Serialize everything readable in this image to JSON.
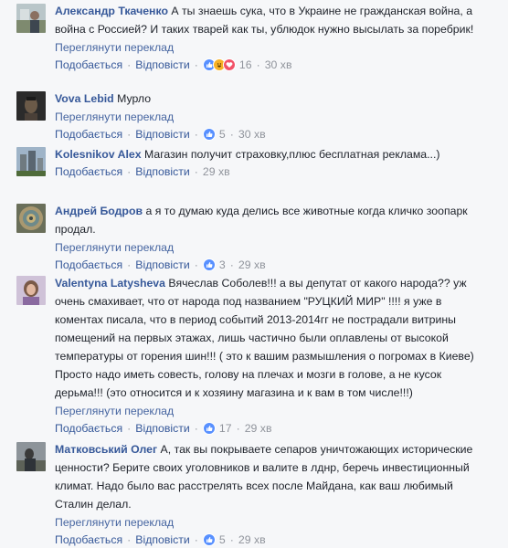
{
  "labels": {
    "translate": "Переглянути переклад",
    "like": "Подобається",
    "reply": "Відповісти",
    "separator": "·"
  },
  "comments": [
    {
      "author": "Александр Ткаченко",
      "text": "А ты знаешь сука, что в Украине не гражданская война, а война с Россией? И таких тварей как ты, ублюдок нужно высылать за поребрик!",
      "reactions": [
        "like-icon",
        "haha-icon",
        "love-icon"
      ],
      "reaction_count": "16",
      "time": "30 хв"
    },
    {
      "author": "Vova Lebid",
      "text": "Мурло",
      "reactions": [
        "like-icon"
      ],
      "reaction_count": "5",
      "time": "30 хв"
    },
    {
      "author": "Kolesnikov Alex",
      "text": "Магазин получит страховку,плюс бесплатная реклама...)",
      "reactions": [],
      "reaction_count": "",
      "time": "29 хв"
    },
    {
      "author": "Андрей Бодров",
      "text": "а я то думаю куда делись все животные когда кличко зоопарк продал.",
      "reactions": [
        "like-icon"
      ],
      "reaction_count": "3",
      "time": "29 хв"
    },
    {
      "author": "Valentyna Latysheva",
      "text": "Вячеслав Соболев!!! а вы депутат от какого народа?? уж очень смахивает, что от народа под названием \"РУЦКИЙ МИР\" !!!! я уже в коментах писала, что в период событий 2013-2014гг не пострадали витрины помещений на первых этажах, лишь частично были оплавлены от высокой температуры от горения шин!!! ( это к вашим размышления о погромах в Киеве) Просто надо иметь совесть, голову на плечах и мозги в голове, а не кусок дерьма!!! (это относится и к хозяину магазина и к вам в том числе!!!)",
      "reactions": [
        "like-icon"
      ],
      "reaction_count": "17",
      "time": "29 хв"
    },
    {
      "author": "Матковський Олег",
      "text": "А, так вы покрываете сепаров уничтожающих исторические ценности? Берите своих уголовников и валите в лднр, беречь инвестиционный климат. Надо было вас расстрелять всех после Майдана, как ваш любимый Сталин делал.",
      "reactions": [
        "like-icon"
      ],
      "reaction_count": "5",
      "time": "29 хв"
    }
  ],
  "colors": {
    "link": "#365899",
    "meta": "#90949c",
    "text": "#1d2129",
    "background": "#f6f7f9",
    "like": "#5890ff",
    "haha": "#f7b125",
    "love": "#f25268"
  }
}
